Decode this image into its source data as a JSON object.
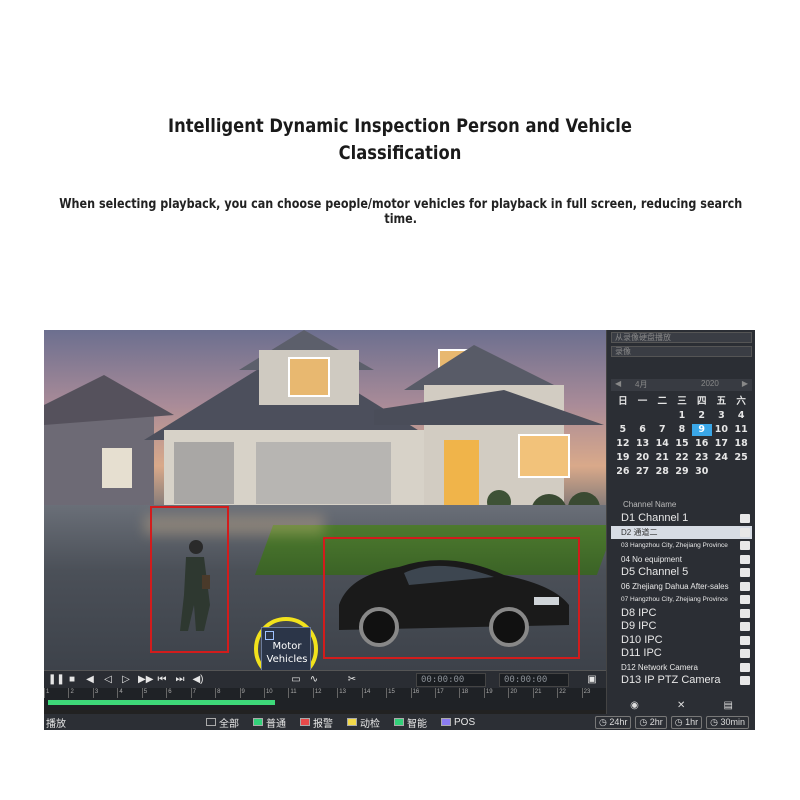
{
  "header": {
    "title_line1": "Intelligent Dynamic Inspection Person and Vehicle",
    "title_line2": "Classification",
    "subtitle": "When selecting playback, you can choose people/motor vehicles for playback in full screen, reducing search time."
  },
  "video": {
    "motor_vehicles_label_1": "Motor",
    "motor_vehicles_label_2": "Vehicles",
    "detection_color": "#d21c1c",
    "highlight_ring_color": "#f2e21c"
  },
  "toolbar": {
    "start_time": "00:00:00",
    "end_time": "00:00:00"
  },
  "timeline": {
    "ticks": [
      "1",
      "2",
      "3",
      "4",
      "5",
      "6",
      "7",
      "8",
      "9",
      "10",
      "11",
      "12",
      "13",
      "14",
      "15",
      "16",
      "17",
      "18",
      "19",
      "20",
      "21",
      "22",
      "23"
    ],
    "recorded_fraction": 0.41
  },
  "legend": {
    "playback_label": "播放",
    "items": [
      {
        "label": "全部",
        "color": "#2c2f35"
      },
      {
        "label": "普通",
        "color": "#33d17a"
      },
      {
        "label": "报警",
        "color": "#e84a4a"
      },
      {
        "label": "动检",
        "color": "#f2d94a"
      },
      {
        "label": "智能",
        "color": "#33d17a"
      },
      {
        "label": "POS",
        "color": "#8b7cf2"
      }
    ],
    "ranges": [
      "24hr",
      "2hr",
      "1hr",
      "30min"
    ]
  },
  "sidebar": {
    "select1": "从录像硬盘播放",
    "select2": "录像",
    "month": "4月",
    "year": "2020",
    "weekdays": [
      "日",
      "一",
      "二",
      "三",
      "四",
      "五",
      "六"
    ],
    "days": [
      "",
      "",
      "",
      "1",
      "2",
      "3",
      "4",
      "5",
      "6",
      "7",
      "8",
      "9",
      "10",
      "11",
      "12",
      "13",
      "14",
      "15",
      "16",
      "17",
      "18",
      "19",
      "20",
      "21",
      "22",
      "23",
      "24",
      "25",
      "26",
      "27",
      "28",
      "29",
      "30",
      "",
      "",
      ""
    ],
    "selected_day": "9",
    "channel_header": "Channel Name",
    "channels": [
      {
        "label": "D1 Channel 1",
        "size": "big",
        "hl": false
      },
      {
        "label": "D2 通道二",
        "size": "mid",
        "hl": true
      },
      {
        "label": "03 Hangzhou City, Zhejiang Province",
        "size": "small",
        "hl": false
      },
      {
        "label": "04 No equipment",
        "size": "mid",
        "hl": false
      },
      {
        "label": "D5 Channel 5",
        "size": "big",
        "hl": false
      },
      {
        "label": "06 Zhejiang Dahua After-sales",
        "size": "mid",
        "hl": false
      },
      {
        "label": "07 Hangzhou City, Zhejiang Province",
        "size": "small",
        "hl": false
      },
      {
        "label": "D8 IPC",
        "size": "big",
        "hl": false
      },
      {
        "label": "D9 IPC",
        "size": "big",
        "hl": false
      },
      {
        "label": "D10 IPC",
        "size": "big",
        "hl": false
      },
      {
        "label": "D11 IPC",
        "size": "big",
        "hl": false
      },
      {
        "label": "D12 Network Camera",
        "size": "mid",
        "hl": false
      },
      {
        "label": "D13 IP PTZ Camera",
        "size": "big",
        "hl": false
      }
    ]
  }
}
